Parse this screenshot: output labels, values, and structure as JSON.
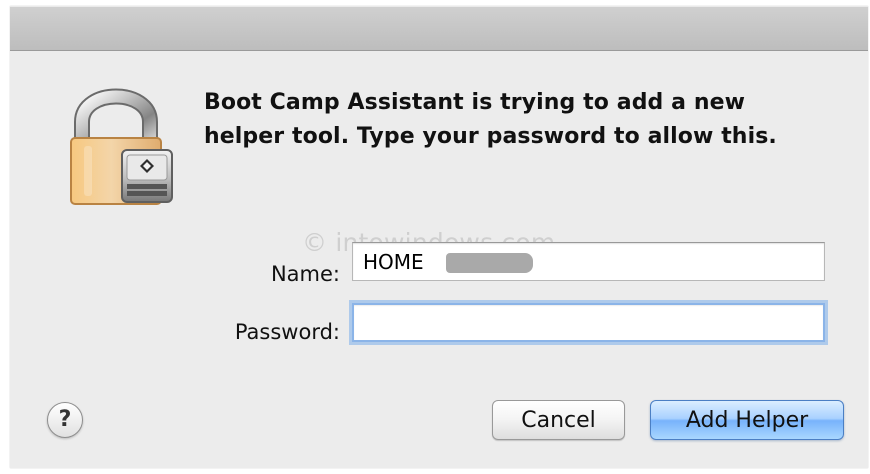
{
  "dialog": {
    "message": {
      "line1": "Boot Camp Assistant is trying to add a new",
      "line2": "helper tool. Type your password to allow this."
    },
    "icons": {
      "main": "lock-icon",
      "badge": "boot-camp-disk-icon",
      "help": "question-mark-icon"
    },
    "watermark": "© intowindows.com",
    "fields": {
      "name_label": "Name:",
      "name_value": "HOME",
      "password_label": "Password:",
      "password_value": ""
    },
    "buttons": {
      "help": "?",
      "cancel": "Cancel",
      "add_helper": "Add Helper"
    },
    "colors": {
      "dialog_background": "#ececec",
      "focus_ring": "#8bb4e8",
      "default_button": "#78b3fb"
    }
  }
}
